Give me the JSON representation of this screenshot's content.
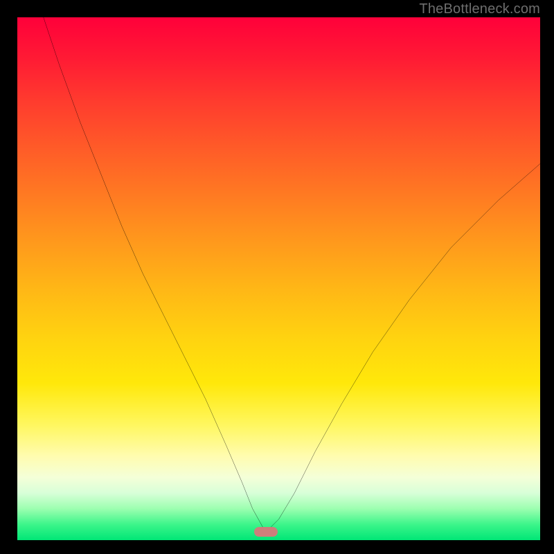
{
  "watermark": "TheBottleneck.com",
  "marker": {
    "cx_pct": 47.5,
    "cy_pct": 98.4
  },
  "chart_data": {
    "type": "line",
    "title": "",
    "xlabel": "",
    "ylabel": "",
    "xlim": [
      0,
      100
    ],
    "ylim": [
      0,
      100
    ],
    "grid": false,
    "note": "Axes are unlabeled in the source image. x is treated as 0–100 across the plot width, y as 0–100 bottom-to-top (0 at the green band, 100 at the top red). Values are estimated from pixel positions.",
    "series": [
      {
        "name": "bottleneck-curve",
        "x": [
          5,
          8,
          12,
          16,
          20,
          24,
          28,
          32,
          36,
          40,
          43,
          45,
          47.5,
          50,
          53,
          57,
          62,
          68,
          75,
          83,
          92,
          100
        ],
        "y": [
          100,
          91,
          80,
          70,
          60,
          51,
          43,
          35,
          27,
          18,
          11,
          6,
          1.5,
          4,
          9,
          17,
          26,
          36,
          46,
          56,
          65,
          72
        ]
      }
    ],
    "annotations": [
      {
        "name": "minimum-marker",
        "x": 47.5,
        "y": 1.5
      }
    ]
  }
}
